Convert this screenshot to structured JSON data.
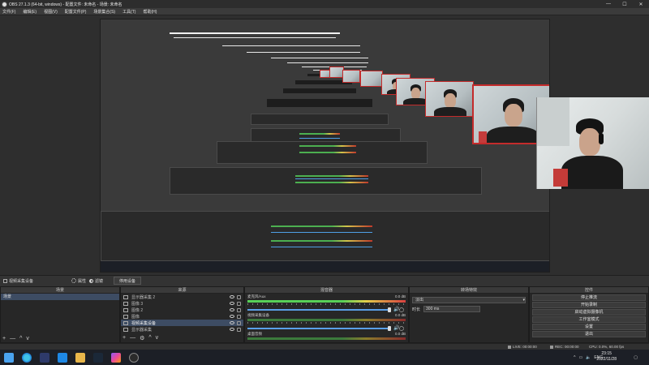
{
  "window": {
    "title": "OBS 27.1.3 (64-bit, windows) - 配置文件: 未命名 - 场景: 未命名",
    "minimize": "—",
    "maximize": "☐",
    "close": "✕"
  },
  "menu": [
    "文件(F)",
    "编辑(E)",
    "视图(V)",
    "配置文件(P)",
    "场景集合(S)",
    "工具(T)",
    "帮助(H)"
  ],
  "dock_bar": {
    "scene_label": "视频采集设备",
    "properties": "属性",
    "filters": "滤镜",
    "deactivate": "停用设备"
  },
  "docks": {
    "scenes": {
      "title": "场景",
      "items": [
        "场景"
      ]
    },
    "sources": {
      "title": "来源",
      "items": [
        {
          "name": "显示器采集 2",
          "selected": false
        },
        {
          "name": "图像 3",
          "selected": false
        },
        {
          "name": "图像 2",
          "selected": false
        },
        {
          "name": "图像",
          "selected": false
        },
        {
          "name": "视频采集设备",
          "selected": true
        },
        {
          "name": "显示器采集",
          "selected": false
        }
      ]
    },
    "mixer": {
      "title": "混音器",
      "channels": [
        {
          "name": "麦克风/Aux",
          "db": "0.0 dB"
        },
        {
          "name": "视频采集设备",
          "db": "0.0 dB"
        },
        {
          "name": "桌面音频",
          "db": "0.0 dB"
        }
      ]
    },
    "transitions": {
      "title": "转场特效",
      "selected": "淡出",
      "duration_label": "时长",
      "duration_value": "300 ms"
    },
    "controls": {
      "title": "控件",
      "buttons": [
        "停止推流",
        "开始录制",
        "启动虚拟摄像机",
        "工作室模式",
        "设置",
        "退出"
      ]
    }
  },
  "tools": {
    "add": "+",
    "remove": "—",
    "up": "^",
    "down": "v",
    "config": "⚙"
  },
  "status": {
    "live": "LIVE: 00:00:00",
    "rec": "REC: 00:00:00",
    "cpu": "CPU: 0.0%, 60.00 fps"
  },
  "taskbar": {
    "time": "23:15",
    "date": "2022/11/28",
    "lang": "ENG"
  },
  "colors": {
    "accent": "#4f9fe6",
    "selection": "#3d4c63",
    "source_border": "#c42b2b"
  }
}
